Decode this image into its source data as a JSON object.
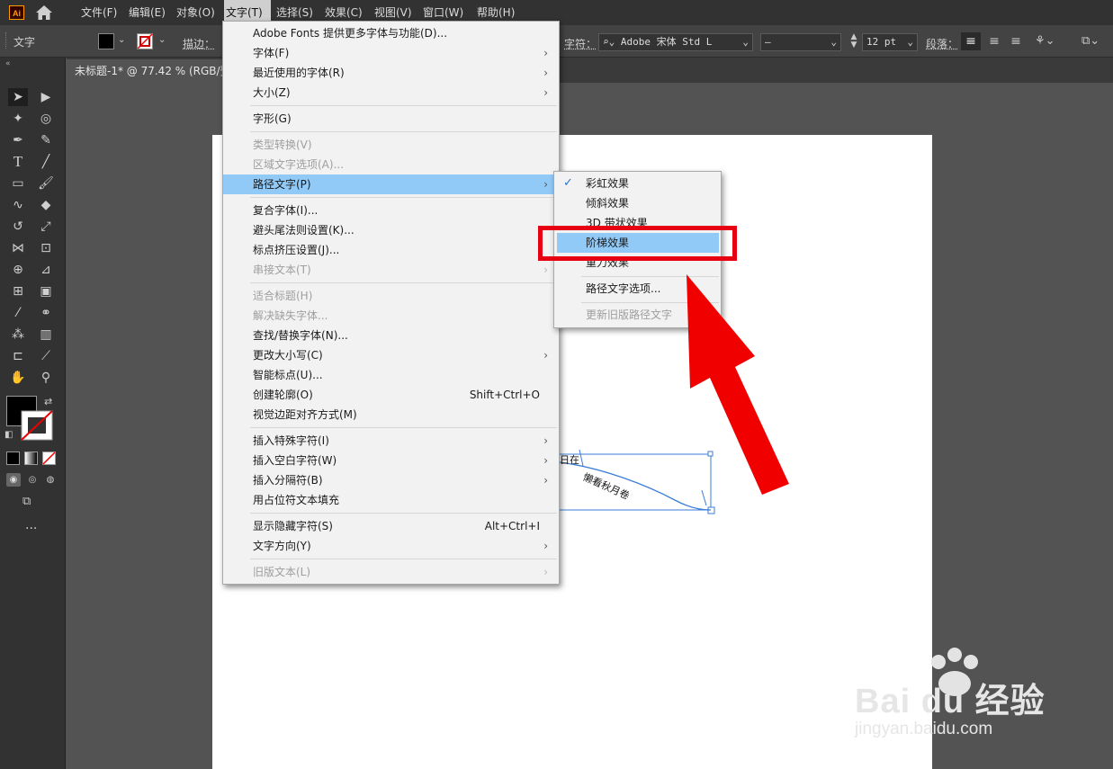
{
  "app": {
    "logo": "Ai"
  },
  "menubar": {
    "items": [
      "文件(F)",
      "编辑(E)",
      "对象(O)",
      "文字(T)",
      "选择(S)",
      "效果(C)",
      "视图(V)",
      "窗口(W)",
      "帮助(H)"
    ],
    "active_index": 3
  },
  "control_bar": {
    "mode_label": "文字",
    "stroke_label": "描边：",
    "char_label": "字符：",
    "font_name": "Adobe 宋体 Std L",
    "font_style": "–",
    "font_size": "12 pt",
    "para_label": "段落："
  },
  "document": {
    "tab_title": "未标题-1* @ 77.42 % (RGB/预"
  },
  "text_menu": {
    "items": [
      {
        "label": "Adobe Fonts 提供更多字体与功能(D)...",
        "enabled": true
      },
      {
        "label": "字体(F)",
        "enabled": true,
        "submenu": true
      },
      {
        "label": "最近使用的字体(R)",
        "enabled": true,
        "submenu": true
      },
      {
        "label": "大小(Z)",
        "enabled": true,
        "submenu": true
      },
      {
        "label": "字形(G)",
        "enabled": true
      },
      {
        "label": "类型转换(V)",
        "enabled": false
      },
      {
        "label": "区域文字选项(A)...",
        "enabled": false
      },
      {
        "label": "路径文字(P)",
        "enabled": true,
        "submenu": true,
        "highlighted": true
      },
      {
        "label": "复合字体(I)...",
        "enabled": true
      },
      {
        "label": "避头尾法则设置(K)...",
        "enabled": true
      },
      {
        "label": "标点挤压设置(J)...",
        "enabled": true
      },
      {
        "label": "串接文本(T)",
        "enabled": false,
        "submenu": true
      },
      {
        "label": "适合标题(H)",
        "enabled": false
      },
      {
        "label": "解决缺失字体...",
        "enabled": false
      },
      {
        "label": "查找/替换字体(N)...",
        "enabled": true
      },
      {
        "label": "更改大小写(C)",
        "enabled": true,
        "submenu": true
      },
      {
        "label": "智能标点(U)...",
        "enabled": true
      },
      {
        "label": "创建轮廓(O)",
        "enabled": true,
        "shortcut": "Shift+Ctrl+O"
      },
      {
        "label": "视觉边距对齐方式(M)",
        "enabled": true
      },
      {
        "label": "插入特殊字符(I)",
        "enabled": true,
        "submenu": true
      },
      {
        "label": "插入空白字符(W)",
        "enabled": true,
        "submenu": true
      },
      {
        "label": "插入分隔符(B)",
        "enabled": true,
        "submenu": true
      },
      {
        "label": "用占位符文本填充",
        "enabled": true
      },
      {
        "label": "显示隐藏字符(S)",
        "enabled": true,
        "shortcut": "Alt+Ctrl+I"
      },
      {
        "label": "文字方向(Y)",
        "enabled": true,
        "submenu": true
      },
      {
        "label": "旧版文本(L)",
        "enabled": false,
        "submenu": true
      }
    ]
  },
  "path_text_submenu": {
    "items": [
      {
        "label": "彩虹效果",
        "checked": true
      },
      {
        "label": "倾斜效果"
      },
      {
        "label": "3D 带状效果"
      },
      {
        "label": "阶梯效果",
        "highlighted": true
      },
      {
        "label": "重力效果"
      },
      {
        "label": "路径文字选项..."
      },
      {
        "label": "更新旧版路径文字",
        "enabled": false
      }
    ]
  },
  "canvas_text": {
    "visible_fragment_a": "日在",
    "visible_fragment_b": "懒看秋月卷"
  },
  "watermark": {
    "brand": "Bai du 经验",
    "url": "jingyan.baidu.com"
  },
  "colors": {
    "highlight": "#91c9f7",
    "callout_red": "#e60012",
    "selection_blue": "#2a6fd1"
  }
}
